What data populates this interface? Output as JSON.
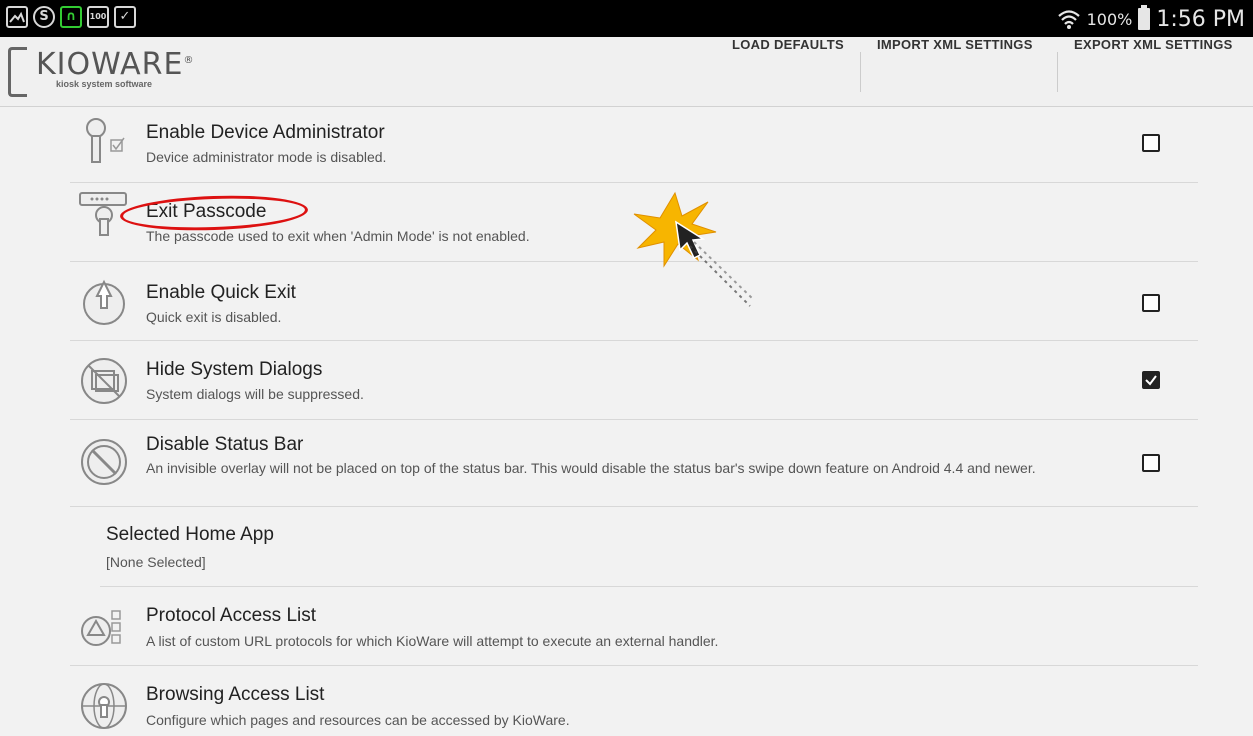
{
  "status_bar": {
    "left_icons": [
      "gallery-icon",
      "s-icon",
      "headset-icon",
      "battery-100-icon",
      "clipboard-check-icon"
    ],
    "battery_percent": "100%",
    "time": "1:56 PM",
    "wifi_icon": "wifi-icon"
  },
  "app": {
    "logo_text": "KIOWARE",
    "logo_registered": "®",
    "logo_tagline": "kiosk system software"
  },
  "actions": {
    "load_defaults": "LOAD DEFAULTS",
    "import_xml": "IMPORT XML SETTINGS",
    "export_xml": "EXPORT XML SETTINGS"
  },
  "settings": [
    {
      "title": "Enable Device Administrator",
      "subtitle": "Device administrator mode is disabled.",
      "icon": "key-check-icon",
      "checkbox": false
    },
    {
      "title": "Exit Passcode",
      "subtitle": "The passcode used to exit when 'Admin Mode' is not enabled.",
      "icon": "passcode-keyhole-icon",
      "checkbox": null
    },
    {
      "title": "Enable Quick Exit",
      "subtitle": "Quick exit is disabled.",
      "icon": "power-exit-icon",
      "checkbox": false
    },
    {
      "title": "Hide System Dialogs",
      "subtitle": "System dialogs will be suppressed.",
      "icon": "hide-dialogs-icon",
      "checkbox": true
    },
    {
      "title": "Disable Status Bar",
      "subtitle": "An invisible overlay will not be placed on top of the status bar. This would disable the status bar's swipe down feature on Android 4.4 and newer.",
      "icon": "no-status-bar-icon",
      "checkbox": false
    },
    {
      "title": "Selected Home App",
      "subtitle": "[None Selected]",
      "icon": null,
      "checkbox": null
    },
    {
      "title": "Protocol Access List",
      "subtitle": "A list of custom URL protocols for which KioWare will attempt to execute an external handler.",
      "icon": "protocol-list-icon",
      "checkbox": null
    },
    {
      "title": "Browsing Access List",
      "subtitle": "Configure which pages and resources can be accessed by KioWare.",
      "icon": "browsing-lock-icon",
      "checkbox": null
    }
  ],
  "colors": {
    "background": "#f2f2f2",
    "status_bar": "#000000",
    "annotation_red": "#dd1111",
    "burst_yellow": "#f7b500"
  }
}
